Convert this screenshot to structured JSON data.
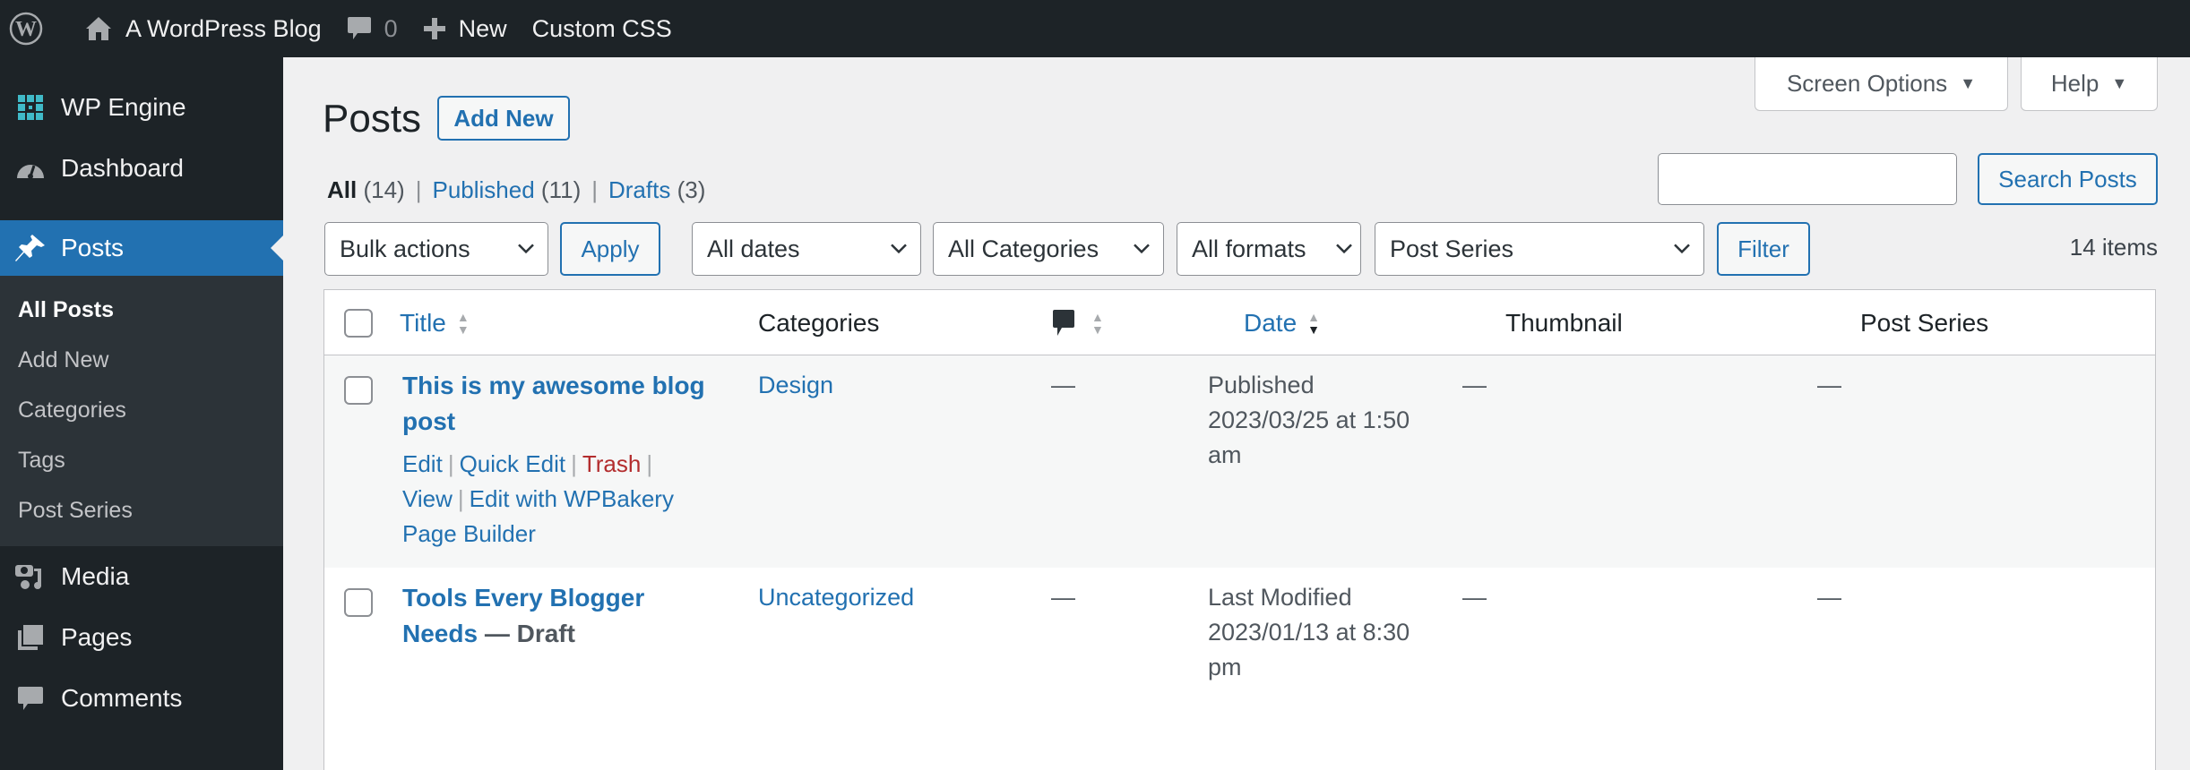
{
  "adminbar": {
    "site_name": "A WordPress Blog",
    "comments_count": "0",
    "new_label": "New",
    "custom_css_label": "Custom CSS"
  },
  "sidebar": {
    "items": [
      {
        "label": "WP Engine",
        "icon": "wp-engine-icon"
      },
      {
        "label": "Dashboard",
        "icon": "dashboard-icon"
      },
      {
        "label": "Posts",
        "icon": "pin-icon",
        "current": true
      },
      {
        "label": "Media",
        "icon": "media-icon"
      },
      {
        "label": "Pages",
        "icon": "pages-icon"
      },
      {
        "label": "Comments",
        "icon": "comments-icon"
      }
    ],
    "submenu": [
      "All Posts",
      "Add New",
      "Categories",
      "Tags",
      "Post Series"
    ]
  },
  "screen_meta": {
    "screen_options": "Screen Options",
    "help": "Help"
  },
  "page": {
    "title": "Posts",
    "add_new": "Add New"
  },
  "views": {
    "all": {
      "label": "All",
      "count": "(14)"
    },
    "published": {
      "label": "Published",
      "count": "(11)"
    },
    "drafts": {
      "label": "Drafts",
      "count": "(3)"
    }
  },
  "search": {
    "value": "",
    "button": "Search Posts"
  },
  "filters": {
    "bulk_actions": "Bulk actions",
    "apply": "Apply",
    "dates": "All dates",
    "categories": "All Categories",
    "formats": "All formats",
    "post_series": "Post Series",
    "filter": "Filter",
    "items_count": "14 items"
  },
  "table": {
    "columns": {
      "title": "Title",
      "categories": "Categories",
      "date": "Date",
      "thumbnail": "Thumbnail",
      "post_series": "Post Series"
    },
    "rows": [
      {
        "title": "This is my awesome blog post",
        "state": "",
        "category": "Design",
        "comments": "—",
        "date_status": "Published",
        "date_value": "2023/03/25 at 1:50 am",
        "thumbnail": "—",
        "post_series": "—",
        "actions": {
          "edit": "Edit",
          "quick_edit": "Quick Edit",
          "trash": "Trash",
          "view": "View",
          "wpbakery": "Edit with WPBakery Page Builder"
        }
      },
      {
        "title": "Tools Every Blogger Needs",
        "state": " — Draft",
        "category": "Uncategorized",
        "comments": "—",
        "date_status": "Last Modified",
        "date_value": "2023/01/13 at 8:30 pm",
        "thumbnail": "—",
        "post_series": "—"
      }
    ]
  },
  "colors": {
    "accent": "#2271b1",
    "adminbar_bg": "#1d2327",
    "trash": "#b32d2e",
    "wp_engine_teal": "#40bac8"
  }
}
